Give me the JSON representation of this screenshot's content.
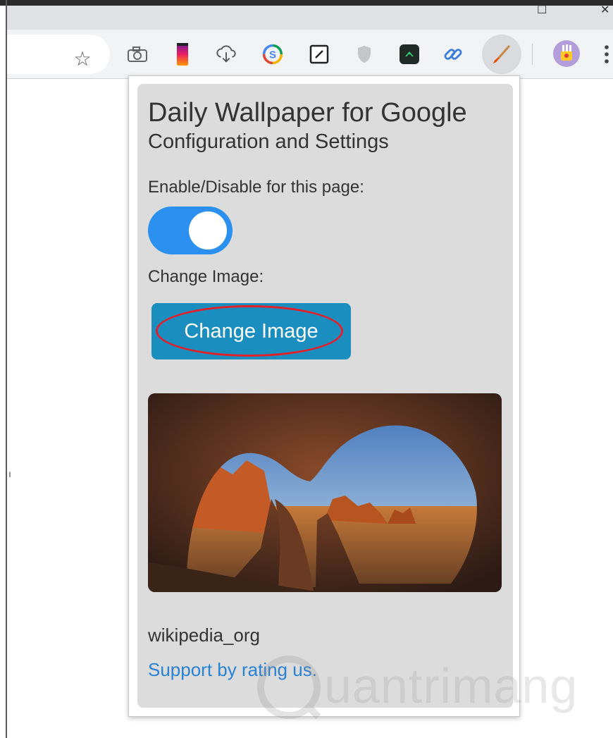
{
  "popup": {
    "title": "Daily Wallpaper for Google",
    "subtitle": "Configuration and Settings",
    "enable_label": "Enable/Disable for this page:",
    "toggle_on": true,
    "change_image_label": "Change Image:",
    "change_image_button": "Change Image",
    "wallpaper_alt": "Cave arch overlooking red rock canyon landscape at sunset",
    "source_text": "wikipedia_org",
    "rate_link": "Support by rating us."
  },
  "toolbar": {
    "icons": [
      "star-icon",
      "camera-icon",
      "phone-gradient-icon",
      "cloud-download-icon",
      "s-extension-icon",
      "edit-box-icon",
      "shield-icon",
      "green-app-icon",
      "link-icon",
      "paintbrush-icon",
      "profile-avatar-icon",
      "menu-icon"
    ],
    "active_extension": "paintbrush-icon"
  },
  "watermark": "uantrimang",
  "colors": {
    "toggle": "#2b90f0",
    "button": "#1a8fbf",
    "highlight_circle": "#e3202a",
    "link": "#2a82d6",
    "panel": "#dcdcdc"
  }
}
